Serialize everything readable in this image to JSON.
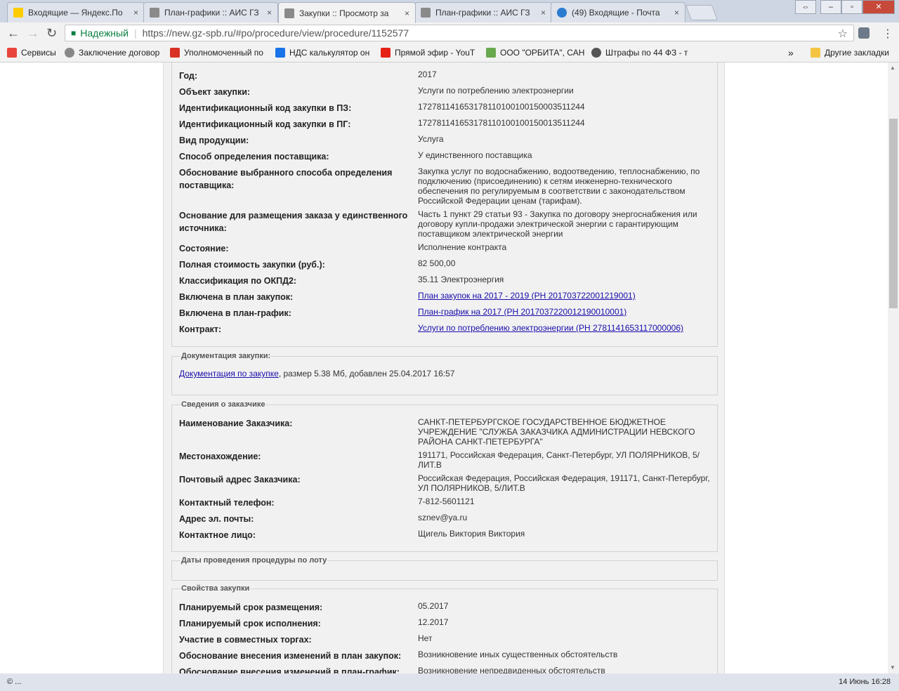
{
  "browser": {
    "tabs": [
      {
        "title": "Входящие — Яндекс.По",
        "color": "#ffcc00"
      },
      {
        "title": "План-графики :: АИС ГЗ",
        "color": "#8a8a8a"
      },
      {
        "title": "Закупки :: Просмотр за",
        "color": "#8a8a8a"
      },
      {
        "title": "План-графики :: АИС ГЗ",
        "color": "#8a8a8a"
      },
      {
        "title": "(49) Входящие - Почта",
        "color": "#2b7bd1"
      }
    ],
    "close_symbol": "×",
    "secure_label": "Надежный",
    "url": "https://new.gz-spb.ru/#po/procedure/view/procedure/1152577",
    "bookmarks": [
      {
        "label": "Сервисы",
        "color": "#e8453c"
      },
      {
        "label": "Заключение договор",
        "color": "#888888"
      },
      {
        "label": "Уполномоченный по",
        "color": "#d93025"
      },
      {
        "label": "НДС калькулятор он",
        "color": "#1a73e8"
      },
      {
        "label": "Прямой эфир - YouT",
        "color": "#e62117"
      },
      {
        "label": "ООО \"ОРБИТА\", САН",
        "color": "#6aa84f"
      },
      {
        "label": "Штрафы по 44 ФЗ - т",
        "color": "#555555"
      }
    ],
    "more_bookmarks": "»",
    "other_bookmarks": "Другие закладки",
    "status_left": "© ...",
    "status_right": "14 Июнь 16:28"
  },
  "procedure": {
    "rows": [
      {
        "k": "Год:",
        "v": "2017"
      },
      {
        "k": "Объект закупки:",
        "v": "Услуги по потреблению электроэнергии"
      },
      {
        "k": "Идентификационный код закупки в ПЗ:",
        "v": "172781141653178110100100150003511244"
      },
      {
        "k": "Идентификационный код закупки в ПГ:",
        "v": "172781141653178110100100150013511244"
      },
      {
        "k": "Вид продукции:",
        "v": "Услуга"
      },
      {
        "k": "Способ определения поставщика:",
        "v": "У единственного поставщика"
      },
      {
        "k": "Обоснование выбранного способа определения поставщика:",
        "v": "Закупка услуг по водоснабжению, водоотведению, теплоснабжению, по подключению (присоединению) к сетям инженерно-технического обеспечения по регулируемым в соответствии с законодательством Российской Федерации ценам (тарифам)."
      },
      {
        "k": "Основание для размещения заказа у единственного источника:",
        "v": "Часть 1 пункт 29 статьи 93 - Закупка по договору энергоснабжения или договору купли-продажи электрической энергии с гарантирующим поставщиком электрической энергии"
      },
      {
        "k": "Состояние:",
        "v": "Исполнение контракта"
      },
      {
        "k": "Полная стоимость закупки (руб.):",
        "v": "82 500,00"
      },
      {
        "k": "Классификация по ОКПД2:",
        "v": "35.11 Электроэнергия"
      },
      {
        "k": "Включена в план закупок:",
        "v": "План закупок на 2017 - 2019 (РН 201703722001219001)"
      },
      {
        "k": "Включена в план-график:",
        "v": "План-график на 2017 (РН 2017037220012190010001)"
      },
      {
        "k": "Контракт:",
        "v": "Услуги по потреблению электроэнергии (РН 2781141653117000006)"
      }
    ]
  },
  "documents": {
    "legend": "Документация закупки:",
    "link": "Документация по закупке",
    "info": ", размер 5.38 Мб, добавлен 25.04.2017 16:57"
  },
  "customer": {
    "legend": "Сведения о заказчике",
    "rows": [
      {
        "k": "Наименование Заказчика:",
        "v": "САНКТ-ПЕТЕРБУРГСКОЕ ГОСУДАРСТВЕННОЕ БЮДЖЕТНОЕ УЧРЕЖДЕНИЕ \"СЛУЖБА ЗАКАЗЧИКА АДМИНИСТРАЦИИ НЕВСКОГО РАЙОНА САНКТ-ПЕТЕРБУРГА\""
      },
      {
        "k": "Местонахождение:",
        "v": "191171, Российская Федерация, Санкт-Петербург, УЛ ПОЛЯРНИКОВ, 5/ЛИТ.В"
      },
      {
        "k": "Почтовый адрес Заказчика:",
        "v": "Российская Федерация, Российская Федерация, 191171, Санкт-Петербург, УЛ ПОЛЯРНИКОВ, 5/ЛИТ.В"
      },
      {
        "k": "Контактный телефон:",
        "v": "7-812-5601121"
      },
      {
        "k": "Адрес эл. почты:",
        "v": "sznev@ya.ru"
      },
      {
        "k": "Контактное лицо:",
        "v": "Щигель Виктория Виктория"
      }
    ]
  },
  "dates": {
    "legend": "Даты проведения процедуры по лоту"
  },
  "properties": {
    "legend": "Свойства закупки",
    "rows": [
      {
        "k": "Планируемый срок размещения:",
        "v": "05.2017"
      },
      {
        "k": "Планируемый срок исполнения:",
        "v": "12.2017"
      },
      {
        "k": "Участие в совместных торгах:",
        "v": "Нет"
      },
      {
        "k": "Обоснование внесения изменений в план закупок:",
        "v": "Возникновение иных существенных обстоятельств"
      },
      {
        "k": "Обоснование внесения изменений в план-график:",
        "v": "Возникновение непредвиденных обстоятельств"
      }
    ]
  }
}
